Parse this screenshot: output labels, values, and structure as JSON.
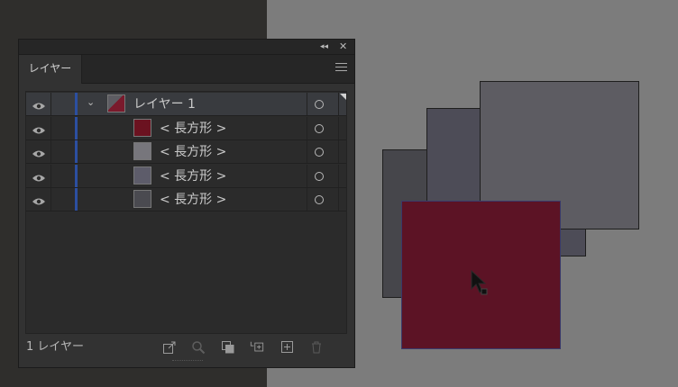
{
  "panel": {
    "tab_label": "レイヤー",
    "collapse_icon": "◂◂",
    "close_icon": "✕",
    "footer_count": "1 レイヤー"
  },
  "layers": [
    {
      "name": "レイヤー 1",
      "thumb_color": "#7a1a2c",
      "is_top": true
    },
    {
      "name": "< 長方形 >",
      "thumb_color": "#6b1220",
      "is_top": false
    },
    {
      "name": "< 長方形 >",
      "thumb_color": "#77767c",
      "is_top": false
    },
    {
      "name": "< 長方形 >",
      "thumb_color": "#5d5c6a",
      "is_top": false
    },
    {
      "name": "< 長方形 >",
      "thumb_color": "#4a4a50",
      "is_top": false
    }
  ],
  "colors": {
    "accent_blue": "#2c4fa0",
    "artboard": "#7c7c7c",
    "rect_crimson": "#5c1325"
  },
  "footer_icons": [
    "export-icon",
    "locate-object-icon",
    "clipping-mask-icon",
    "new-sublayer-icon",
    "new-layer-icon",
    "delete-icon"
  ]
}
